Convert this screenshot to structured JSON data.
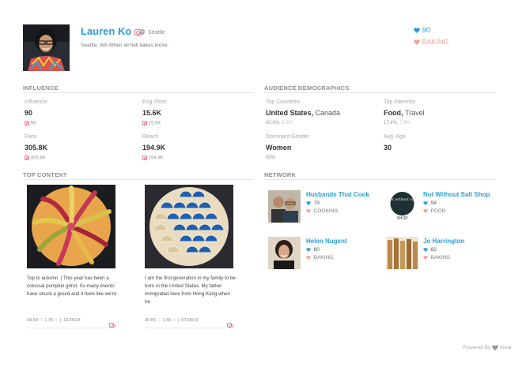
{
  "profile": {
    "name": "Lauren Ko",
    "location": "Seattle",
    "bio": "Seattle, WA When all hell bakes loose.",
    "score": "90",
    "topic": "BAKING"
  },
  "influence": {
    "title": "INFLUENCE",
    "items": [
      {
        "label": "Influence",
        "value": "90",
        "sub": "96"
      },
      {
        "label": "Eng./Post",
        "value": "15.6K",
        "sub": "15.6K"
      },
      {
        "label": "Fans",
        "value": "305.8K",
        "sub": "305.8K"
      },
      {
        "label": "Reach",
        "value": "194.9K",
        "sub": "194.9K"
      }
    ]
  },
  "demographics": {
    "title": "AUDIENCE DEMOGRAPHICS",
    "countries": {
      "label": "Top Countries",
      "value_main": "United States,",
      "value_extra": "Canada",
      "sub_main": "60.9%,",
      "sub_extra": "6.5%"
    },
    "interests": {
      "label": "Top Interests",
      "value_main": "Food,",
      "value_extra": "Travel",
      "sub_main": "17.4%,",
      "sub_extra": "7.8%"
    },
    "gender": {
      "label": "Dominant Gender",
      "value": "Women",
      "sub": "85%"
    },
    "age": {
      "label": "Avg. Age",
      "value": "30"
    }
  },
  "top_content": {
    "title": "TOP CONTENT",
    "posts": [
      {
        "caption": "Top to autumn.     | This year has been a colossal pumpkin grind. So many events have struck a gourd and it feels like we're",
        "likes": "44.6K",
        "comments": "1.7K",
        "date": "10/25/18"
      },
      {
        "caption": "I am the first generation in my family to be born in the United States. My father immigrated here from Hong Kong when he",
        "likes": "40.8K",
        "comments": "1.5K",
        "date": "07/18/19"
      }
    ]
  },
  "network": {
    "title": "NETWORK",
    "items": [
      {
        "name": "Husbands That Cook",
        "score": "79",
        "topic": "COOKING"
      },
      {
        "name": "Not Without Salt Shop",
        "score": "58",
        "topic": "FOOD",
        "logo_text": "not without salt",
        "logo_sub": "SHOP"
      },
      {
        "name": "Helen Nugent",
        "score": "80",
        "topic": "BAKING"
      },
      {
        "name": "Jo Harrington",
        "score": "82",
        "topic": "BAKING"
      }
    ]
  },
  "footer": {
    "powered_by": "Powered By",
    "brand": "Klear"
  },
  "colors": {
    "accent": "#2a9fd6",
    "topic": "#f2a38f",
    "instagram": "#e8748a"
  },
  "icons": [
    "instagram-icon",
    "location-pin-icon",
    "heart-icon",
    "comment-icon",
    "klear-logo-icon"
  ]
}
